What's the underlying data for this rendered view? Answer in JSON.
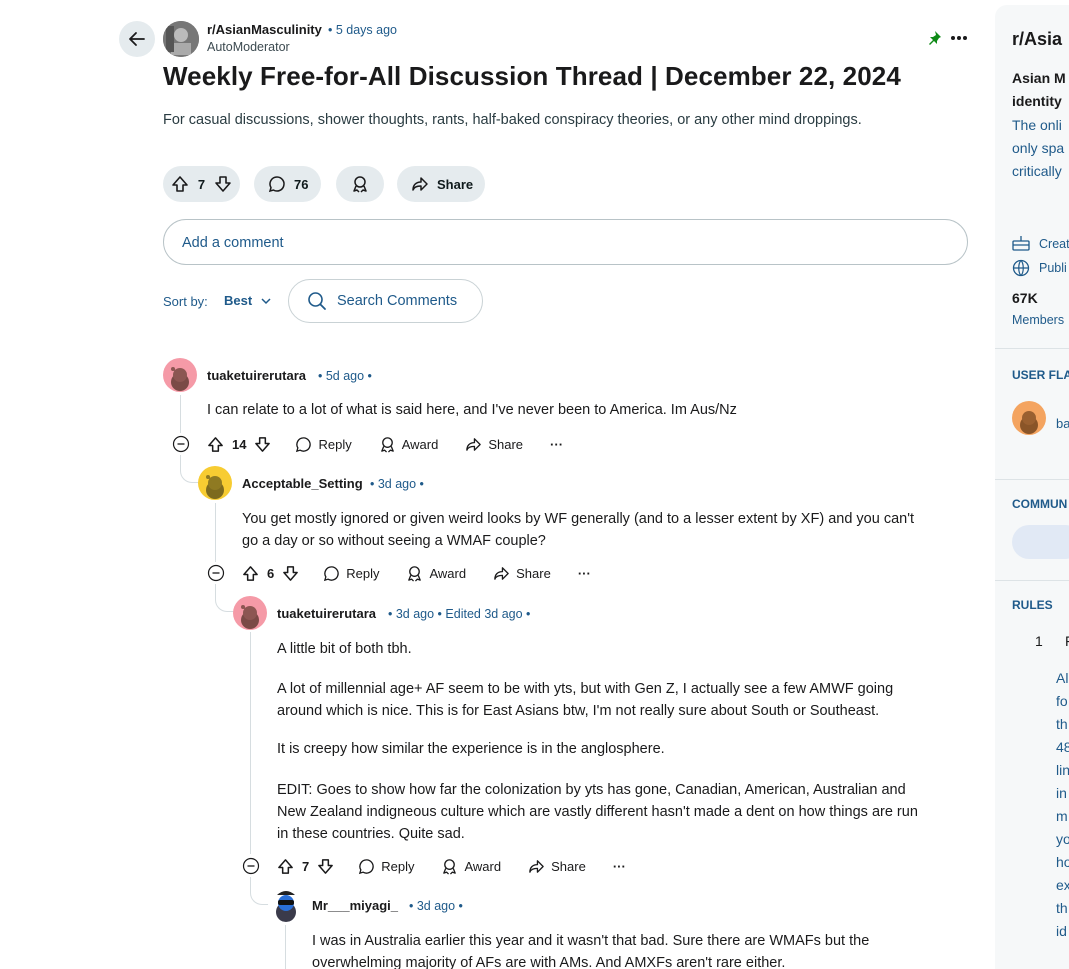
{
  "post": {
    "subreddit": "r/AsianMasculinity",
    "time": "• 5 days ago",
    "author": "AutoModerator",
    "title": "Weekly Free-for-All Discussion Thread | December 22, 2024",
    "body": "For casual discussions, shower thoughts, rants, half-baked conspiracy theories, or any other mind droppings.",
    "votes": "7",
    "comments": "76",
    "share_label": "Share"
  },
  "comment_box": {
    "placeholder": "Add a comment"
  },
  "sort": {
    "label": "Sort by:",
    "value": "Best",
    "search_label": "Search Comments"
  },
  "actions": {
    "reply": "Reply",
    "award": "Award",
    "share": "Share",
    "more": "···"
  },
  "comments": [
    {
      "user": "tuaketuirerutara",
      "meta": "• 5d ago •",
      "lines": [
        "I can relate to a lot of what is said here, and I've never been to America. Im  Aus/Nz"
      ],
      "votes": "14"
    },
    {
      "user": "Acceptable_Setting",
      "meta": "• 3d ago •",
      "lines": [
        "You get mostly ignored or given weird looks by WF generally (and to a lesser extent by XF) and you can't",
        "go a day or so without seeing a WMAF couple?"
      ],
      "votes": "6"
    },
    {
      "user": "tuaketuirerutara",
      "meta": "• 3d ago • Edited 3d ago •",
      "p1": "A little bit of both tbh.",
      "p2": [
        "A lot of millennial age+ AF seem to be with yts, but with Gen Z, I actually see a few AMWF going",
        "around which is nice. This is for East Asians btw, I'm not really sure about South or Southeast."
      ],
      "p3": "It is creepy how similar the experience is in the anglosphere.",
      "p4": [
        "EDIT: Goes to show how far the colonization by yts has gone, Canadian, American, Australian and",
        "New Zealand indigneous culture which are vastly different hasn't made a dent on how things are run",
        "in these countries. Quite sad."
      ],
      "votes": "7"
    },
    {
      "user": "Mr___miyagi_",
      "meta": "• 3d ago •",
      "lines": [
        "I was in Australia earlier this year and it wasn't that bad. Sure there are WMAFs but the",
        "overwhelming majority of AFs are with AMs. And AMXFs aren't rare either."
      ]
    }
  ],
  "sidebar": {
    "title": "r/Asia",
    "desc_bold": [
      "Asian M",
      "identity"
    ],
    "desc": [
      "The onli",
      "only spa",
      "critically"
    ],
    "created": "Creat",
    "public": "Publi",
    "members_count": "67K",
    "members_label": "Members",
    "user_flair": "USER FLA",
    "flair_name": "ba",
    "community": "COMMUN",
    "rules": "RULES",
    "rule_num": "1",
    "rule_letter": "F",
    "rule_text": [
      "Al",
      "fo",
      "th",
      "48",
      "lin",
      "in",
      "m",
      "yo",
      "ho",
      "ex",
      "th",
      "id"
    ]
  },
  "colors": {
    "accent": "#0a449b",
    "pin": "#0e8a16",
    "pill": "#e5ebee"
  }
}
